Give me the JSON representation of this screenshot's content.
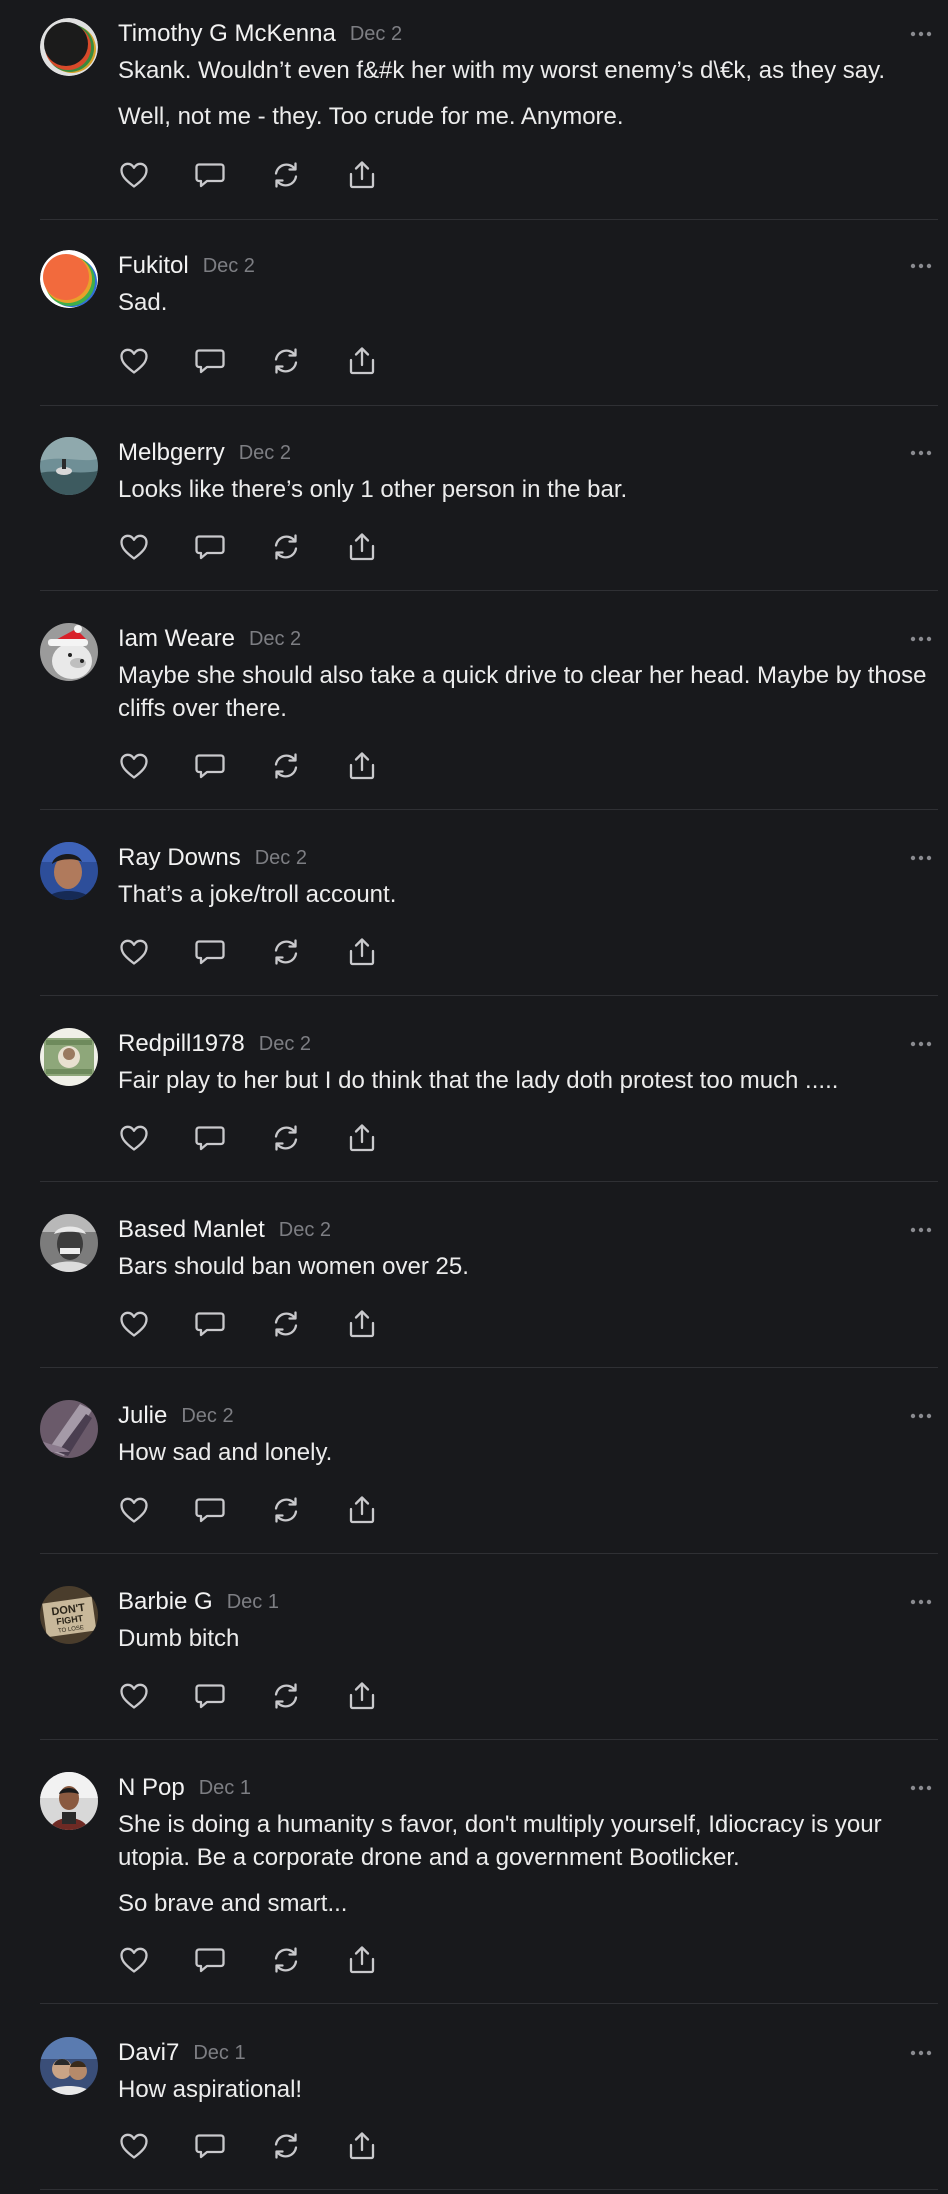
{
  "colors": {
    "background": "#18191c",
    "divider": "#2f3034",
    "text": "#ececec",
    "muted": "#7d7e83",
    "icon": "#c9c9cc"
  },
  "icons": {
    "like": "heart-icon",
    "reply": "comment-icon",
    "restack": "restack-icon",
    "share": "share-icon",
    "more": "ellipsis-icon"
  },
  "comments": [
    {
      "author": "Timothy G McKenna",
      "date": "Dec 2",
      "paragraphs": [
        "Skank. Wouldn’t even f&#k her with my worst enemy’s d\\€k, as they say.",
        "Well, not me - they. Too crude for me. Anymore."
      ]
    },
    {
      "author": "Fukitol",
      "date": "Dec 2",
      "paragraphs": [
        "Sad."
      ]
    },
    {
      "author": "Melbgerry",
      "date": "Dec 2",
      "paragraphs": [
        "Looks like there’s only 1 other person in the bar."
      ]
    },
    {
      "author": "Iam Weare",
      "date": "Dec 2",
      "paragraphs": [
        "Maybe she should also take a quick drive to clear her head. Maybe by those cliffs over there."
      ]
    },
    {
      "author": "Ray Downs",
      "date": "Dec 2",
      "paragraphs": [
        "That’s a joke/troll account."
      ]
    },
    {
      "author": "Redpill1978",
      "date": "Dec 2",
      "paragraphs": [
        "Fair play to her but I do think that the lady doth protest too much ....."
      ]
    },
    {
      "author": "Based Manlet",
      "date": "Dec 2",
      "paragraphs": [
        "Bars should ban women over 25."
      ]
    },
    {
      "author": "Julie",
      "date": "Dec 2",
      "paragraphs": [
        "How sad and lonely."
      ]
    },
    {
      "author": "Barbie G",
      "date": "Dec 1",
      "paragraphs": [
        "Dumb bitch"
      ],
      "avatar_text": "DON'T FIGHT TO LOSE"
    },
    {
      "author": "N Pop",
      "date": "Dec 1",
      "paragraphs": [
        "She is doing a humanity s favor, don't multiply yourself, Idiocracy is your utopia. Be a corporate drone and a government Bootlicker.",
        "So brave and smart..."
      ]
    },
    {
      "author": "Davi7",
      "date": "Dec 1",
      "paragraphs": [
        "How aspirational!"
      ]
    }
  ]
}
